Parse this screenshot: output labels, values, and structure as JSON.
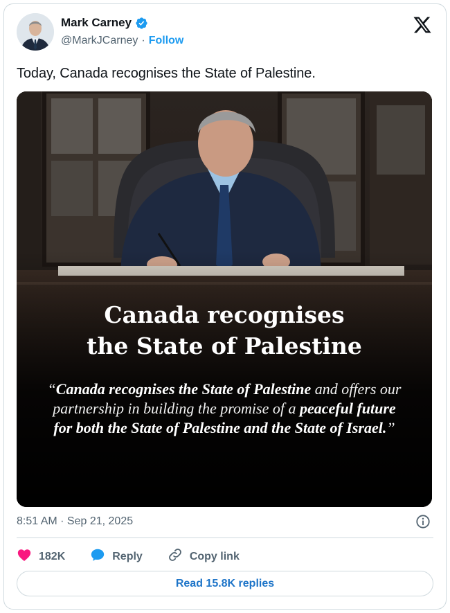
{
  "author": {
    "name": "Mark Carney",
    "handle": "@MarkJCarney",
    "separator": "·",
    "follow_label": "Follow"
  },
  "tweet": {
    "text": "Today, Canada recognises the State of Palestine."
  },
  "media": {
    "headline_line1": "Canada recognises",
    "headline_line2": "the State of Palestine",
    "quote_open": "“",
    "quote_bold1": "Canada recognises the State of Palestine",
    "quote_mid": " and offers our partnership in building the promise of a ",
    "quote_bold2": "peaceful future for both the State of Palestine and the State of Israel.",
    "quote_close": "”"
  },
  "meta": {
    "timestamp": "8:51 AM · Sep 21, 2025"
  },
  "actions": {
    "likes": "182K",
    "reply_label": "Reply",
    "copy_label": "Copy link"
  },
  "read_replies_label": "Read 15.8K replies",
  "colors": {
    "accent": "#1d9bf0",
    "like": "#f91880",
    "reply": "#1d9bf0",
    "read_button_text": "#1d74c8"
  },
  "icons": [
    "verified-badge-icon",
    "x-logo-icon",
    "info-icon",
    "heart-icon",
    "reply-bubble-icon",
    "link-icon"
  ]
}
